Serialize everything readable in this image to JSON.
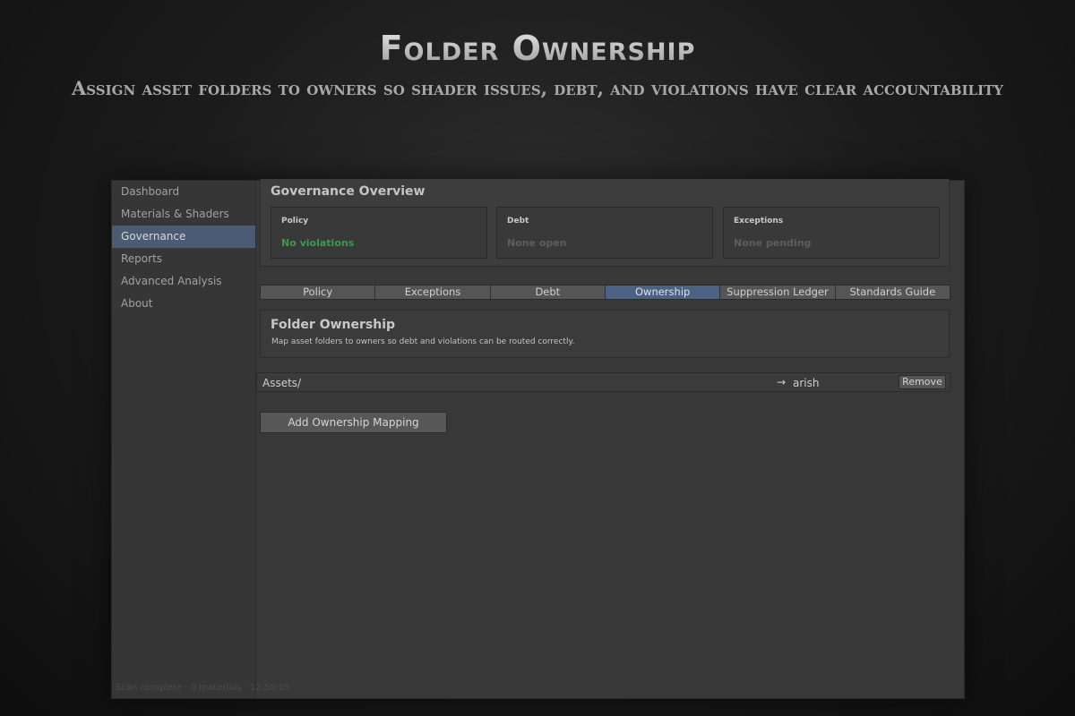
{
  "hero": {
    "title": "Folder Ownership",
    "subtitle": "Assign asset folders to owners so shader issues, debt, and violations have clear accountability"
  },
  "sidebar": {
    "items": [
      {
        "label": "Dashboard",
        "active": false
      },
      {
        "label": "Materials & Shaders",
        "active": false
      },
      {
        "label": "Governance",
        "active": true
      },
      {
        "label": "Reports",
        "active": false
      },
      {
        "label": "Advanced Analysis",
        "active": false
      },
      {
        "label": "About",
        "active": false
      }
    ]
  },
  "overview": {
    "title": "Governance Overview",
    "cards": [
      {
        "label": "Policy",
        "value": "No violations"
      },
      {
        "label": "Debt",
        "value": "None open"
      },
      {
        "label": "Exceptions",
        "value": "None pending"
      }
    ]
  },
  "tabs": [
    {
      "label": "Policy"
    },
    {
      "label": "Exceptions"
    },
    {
      "label": "Debt"
    },
    {
      "label": "Ownership"
    },
    {
      "label": "Suppression Ledger"
    },
    {
      "label": "Standards Guide"
    }
  ],
  "active_tab": "Ownership",
  "folder_ownership": {
    "title": "Folder Ownership",
    "description": "Map asset folders to owners so debt and violations can be routed correctly."
  },
  "mappings": [
    {
      "folder": "Assets/",
      "arrow": "→",
      "owner": "arish",
      "remove_label": "Remove"
    }
  ],
  "add_button_label": "Add Ownership Mapping",
  "status_bar": "Scan complete · 0 materials · 12:50:05",
  "colors": {
    "accent_active": "#4c6283",
    "success": "#3d9a4c",
    "sidebar_active": "#4a5b73"
  }
}
